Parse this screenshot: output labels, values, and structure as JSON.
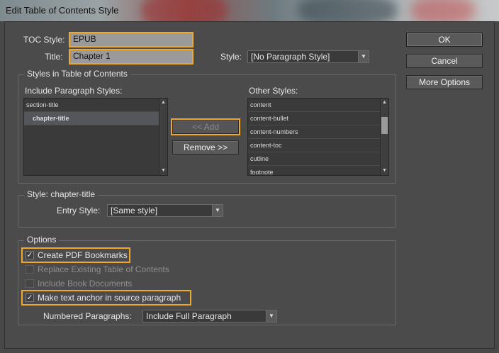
{
  "window": {
    "title": "Edit Table of Contents Style"
  },
  "toc_style": {
    "label": "TOC Style:",
    "value": "EPUB"
  },
  "title": {
    "label": "Title:",
    "value": "Chapter 1"
  },
  "title_style": {
    "label": "Style:",
    "value": "[No Paragraph Style]"
  },
  "buttons": {
    "ok": "OK",
    "cancel": "Cancel",
    "more_options": "More Options",
    "add": "<< Add",
    "remove": "Remove >>"
  },
  "styles_group": {
    "title": "Styles in Table of Contents",
    "include_label": "Include Paragraph Styles:",
    "include_items": [
      "section-title",
      "chapter-title"
    ],
    "include_selected": "chapter-title",
    "other_label": "Other Styles:",
    "other_items": [
      "content",
      "content-bullet",
      "content-numbers",
      "content-toc",
      "cutline",
      "footnote"
    ]
  },
  "style_group": {
    "title": "Style: chapter-title",
    "entry_label": "Entry Style:",
    "entry_value": "[Same style]"
  },
  "options_group": {
    "title": "Options",
    "create_pdf_bookmarks": {
      "label": "Create PDF Bookmarks",
      "checked": true,
      "enabled": true
    },
    "replace_existing": {
      "label": "Replace Existing Table of Contents",
      "checked": false,
      "enabled": false
    },
    "include_book_docs": {
      "label": "Include Book Documents",
      "checked": false,
      "enabled": false
    },
    "make_anchor": {
      "label": "Make text anchor in source paragraph",
      "checked": true,
      "enabled": true
    },
    "numbered_label": "Numbered Paragraphs:",
    "numbered_value": "Include Full Paragraph"
  },
  "colors": {
    "highlight": "#f0a82a",
    "panel": "#4b4b4b"
  }
}
